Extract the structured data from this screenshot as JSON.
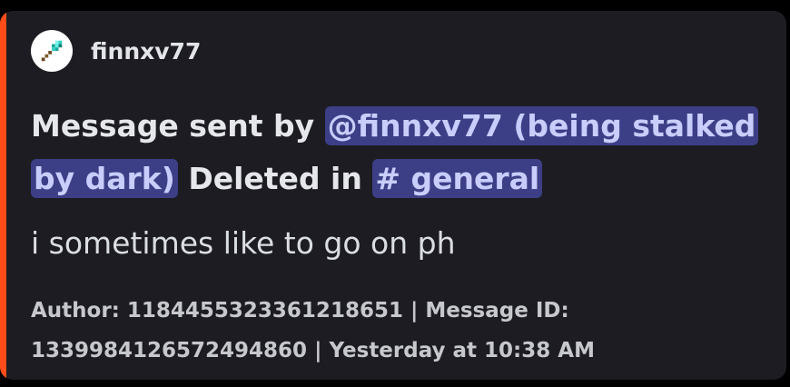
{
  "embed": {
    "accent_color": "#ff4d1a",
    "author": {
      "avatar_icon": "diamond-shovel-icon",
      "name": "finnxv77"
    },
    "title": {
      "prefix": "Message sent by ",
      "user_mention": "@finnxv77 (being stalked by dark)",
      "middle": " Deleted in ",
      "channel_mention": "# general"
    },
    "description": "i sometimes like to go on ph",
    "footer": {
      "text": "Author: 1184455323361218651 | Message ID: 1339984126572494860 | Yesterday at 10:38 AM"
    }
  }
}
